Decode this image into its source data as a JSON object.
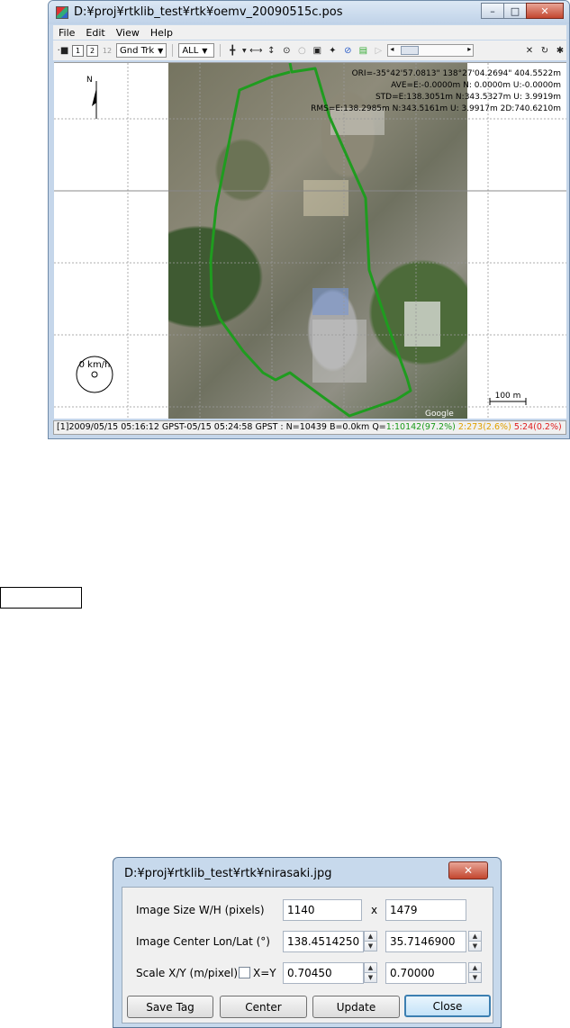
{
  "main_window": {
    "title": "D:¥proj¥rtklib_test¥rtk¥oemv_20090515c.pos",
    "caption_buttons": {
      "minimize": "–",
      "maximize": "□",
      "close": "✕"
    },
    "menu": [
      "File",
      "Edit",
      "View",
      "Help"
    ],
    "toolbar": {
      "btn1": "1",
      "btn2": "2",
      "btn12": "12",
      "plot_type": "Gnd Trk",
      "quality_filter": "ALL"
    },
    "stats": {
      "ori": "ORI=-35°42'57.0813\" 138°27'04.2694\" 404.5522m",
      "ave": "AVE=E:-0.0000m N: 0.0000m U:-0.0000m",
      "std": "STD=E:138.3051m N:343.5327m U: 3.9919m",
      "rms": "RMS=E:138.2985m N:343.5161m U: 3.9917m 2D:740.6210m"
    },
    "north_label": "N",
    "speed_label": "0 km/h",
    "scale_label": "100 m",
    "google_mark": "Google",
    "status": {
      "prefix": "[1]2009/05/15 05:16:12 GPST-05/15 05:24:58 GPST : N=10439 B=0.0km Q=",
      "q1": "1:10142(97.2%)",
      "q2": "2:273(2.6%)",
      "q5": "5:24(0.2%)"
    }
  },
  "dialog": {
    "title": "D:¥proj¥rtklib_test¥rtk¥nirasaki.jpg",
    "close_glyph": "✕",
    "image_size_label": "Image Size W/H (pixels)",
    "width": "1140",
    "times": "x",
    "height": "1479",
    "center_label": "Image Center Lon/Lat (°)",
    "lon": "138.4514250",
    "lat": "35.7146900",
    "scale_label": "Scale X/Y (m/pixel)",
    "xy_label": "X=Y",
    "scale_x": "0.70450",
    "scale_y": "0.70000",
    "buttons": {
      "save_tag": "Save Tag",
      "center": "Center",
      "update": "Update",
      "close": "Close"
    }
  }
}
